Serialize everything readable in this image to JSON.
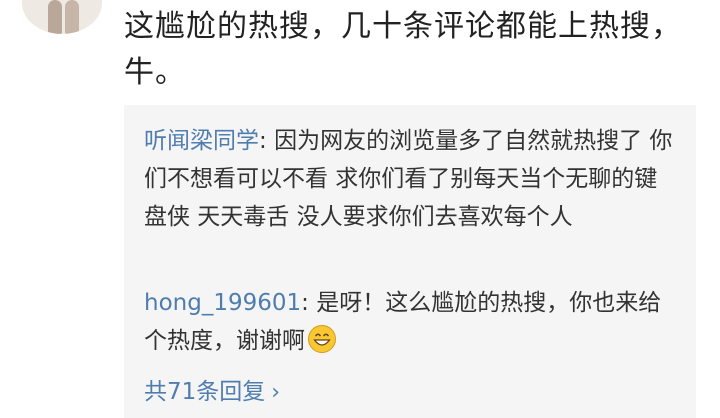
{
  "comment": {
    "text": "这尴尬的热搜，几十条评论都能上热搜，牛。"
  },
  "replies": [
    {
      "user": "听闻梁同学",
      "separator": ": ",
      "text": "因为网友的浏览量多了自然就热搜了   你们不想看可以不看   求你们看了别每天当个无聊的键盘侠   天天毒舌   没人要求你们去喜欢每个人"
    },
    {
      "user": "hong_199601",
      "separator": ": ",
      "text": "是呀！这么尴尬的热搜，你也来给个热度，谢谢啊",
      "emoji": "grinning-face-icon"
    }
  ],
  "more_replies_label": "共71条回复",
  "colors": {
    "link": "#507daf",
    "text": "#222222",
    "reply_bg": "#f5f5f5"
  }
}
